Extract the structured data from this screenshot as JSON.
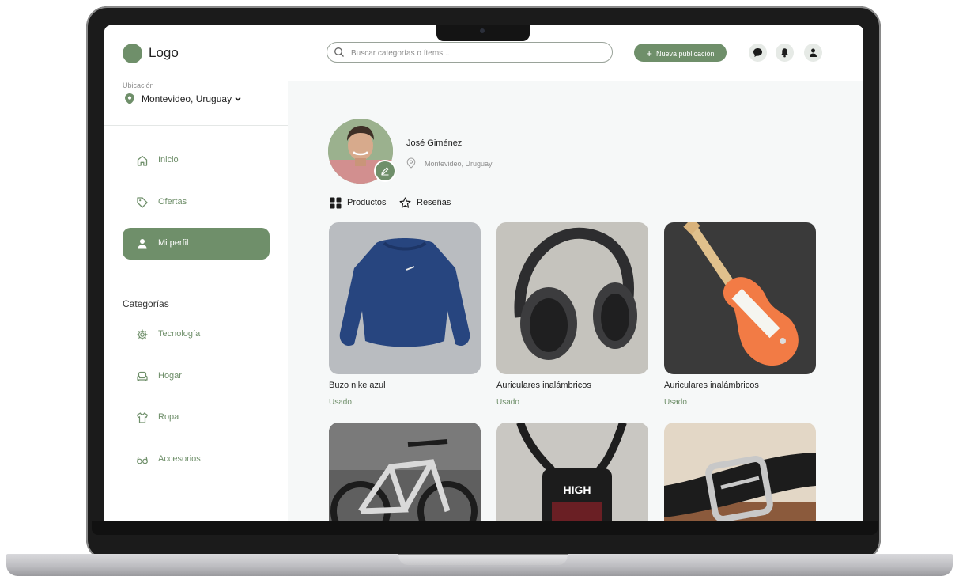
{
  "brand": {
    "logo_text": "Logo",
    "accent": "#6f8f6a"
  },
  "location": {
    "label": "Ubicación",
    "value": "Montevideo, Uruguay"
  },
  "nav": [
    {
      "label": "Inicio",
      "icon": "home-icon",
      "active": false
    },
    {
      "label": "Ofertas",
      "icon": "tag-icon",
      "active": false
    },
    {
      "label": "Mi perfil",
      "icon": "user-icon",
      "active": true
    }
  ],
  "categories": {
    "title": "Categorías",
    "items": [
      {
        "label": "Tecnología",
        "icon": "gear-icon"
      },
      {
        "label": "Hogar",
        "icon": "armchair-icon"
      },
      {
        "label": "Ropa",
        "icon": "shirt-icon"
      },
      {
        "label": "Accesorios",
        "icon": "glasses-icon"
      }
    ]
  },
  "topbar": {
    "search_placeholder": "Buscar categorías o ítems...",
    "new_post_label": "Nueva publicación",
    "icons": [
      "chat-icon",
      "bell-icon",
      "user-icon"
    ]
  },
  "profile": {
    "name": "José Giménez",
    "location": "Montevideo, Uruguay"
  },
  "tabs": [
    {
      "label": "Productos",
      "icon": "grid-icon"
    },
    {
      "label": "Reseñas",
      "icon": "star-icon"
    }
  ],
  "products": [
    {
      "title": "Buzo nike azul",
      "condition": "Usado",
      "image": "blue-sweatshirt"
    },
    {
      "title": "Auriculares inalámbricos",
      "condition": "Usado",
      "image": "headphones"
    },
    {
      "title": "Auriculares inalámbricos",
      "condition": "Usado",
      "image": "electric-guitar"
    },
    {
      "title": "",
      "condition": "",
      "image": "bicycle"
    },
    {
      "title": "",
      "condition": "",
      "image": "shoulder-bag"
    },
    {
      "title": "",
      "condition": "",
      "image": "leather-belt"
    }
  ]
}
